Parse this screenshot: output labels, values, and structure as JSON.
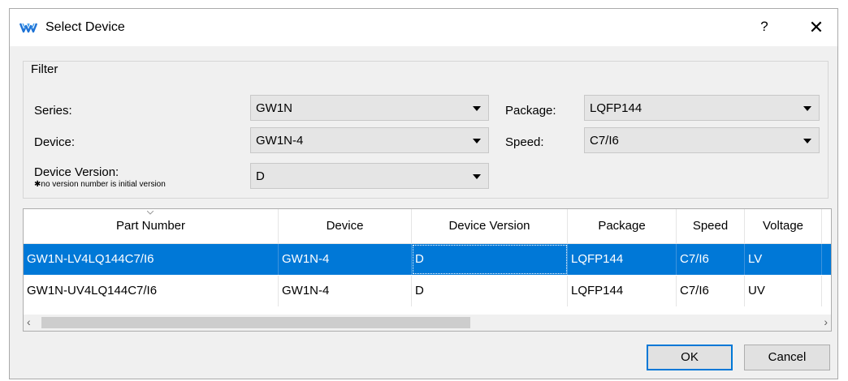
{
  "window": {
    "title": "Select Device",
    "help_glyph": "?",
    "close_glyph": "✕"
  },
  "filter": {
    "legend": "Filter",
    "series_label": "Series:",
    "series_value": "GW1N",
    "device_label": "Device:",
    "device_value": "GW1N-4",
    "version_label": "Device Version:",
    "version_note": "✱no version number is initial version",
    "version_value": "D",
    "package_label": "Package:",
    "package_value": "LQFP144",
    "speed_label": "Speed:",
    "speed_value": "C7/I6"
  },
  "table": {
    "columns": [
      "Part Number",
      "Device",
      "Device Version",
      "Package",
      "Speed",
      "Voltage"
    ],
    "rows": [
      [
        "GW1N-LV4LQ144C7/I6",
        "GW1N-4",
        "D",
        "LQFP144",
        "C7/I6",
        "LV"
      ],
      [
        "GW1N-UV4LQ144C7/I6",
        "GW1N-4",
        "D",
        "LQFP144",
        "C7/I6",
        "UV"
      ]
    ],
    "selected_row": 0,
    "scroll_left_glyph": "‹",
    "scroll_right_glyph": "›"
  },
  "buttons": {
    "ok": "OK",
    "cancel": "Cancel"
  },
  "colors": {
    "selection": "#0078d7",
    "dialog_bg": "#f0f0f0",
    "logo": "#1e73d6"
  },
  "icons": {
    "app": "gowin-logo-icon",
    "sort": "sort-indicator-icon"
  }
}
